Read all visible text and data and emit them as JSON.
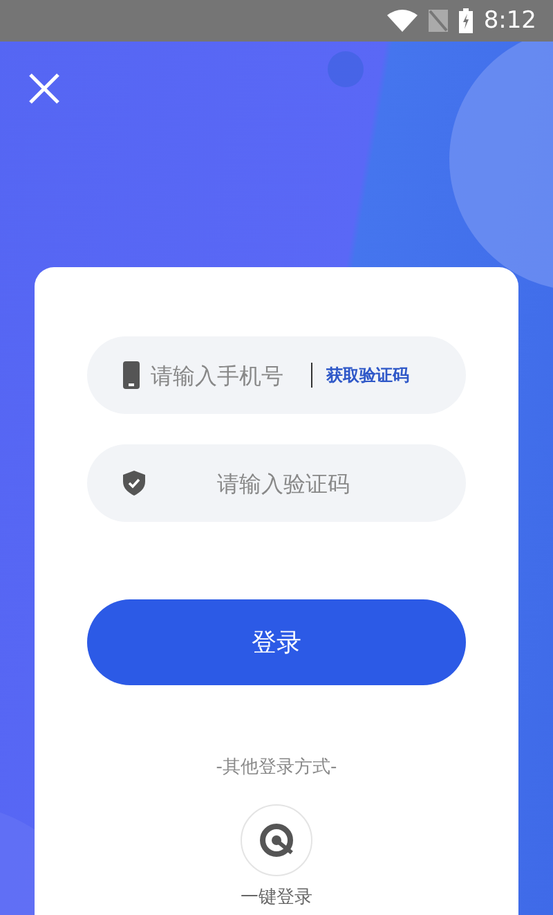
{
  "status_bar": {
    "time": "8:12"
  },
  "phone_field": {
    "placeholder": "请输入手机号",
    "get_code_link": "获取验证码"
  },
  "code_field": {
    "placeholder": "请输入验证码"
  },
  "login_button": "登录",
  "other_methods_label": "-其他登录方式-",
  "one_tap_login": {
    "label": "一键登录"
  }
}
